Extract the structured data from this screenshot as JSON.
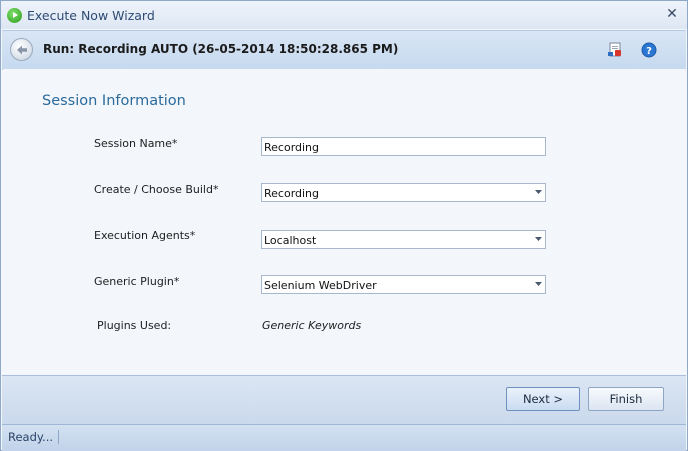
{
  "window": {
    "title": "Execute Now Wizard",
    "close_glyph": "✕",
    "icon": "play-icon"
  },
  "header": {
    "run_title": "Run: Recording AUTO (26-05-2014 18:50:28.865 PM)",
    "back_icon": "back-arrow-icon",
    "report_icon": "report-icon",
    "help_icon": "help-icon"
  },
  "section": {
    "title": "Session Information"
  },
  "form": {
    "session_name": {
      "label": "Session Name*",
      "value": "Recording"
    },
    "build": {
      "label": "Create / Choose Build*",
      "value": "Recording"
    },
    "agents": {
      "label": "Execution Agents*",
      "value": "Localhost"
    },
    "plugin": {
      "label": "Generic Plugin*",
      "value": "Selenium WebDriver"
    },
    "plugins_used": {
      "label": "Plugins Used:",
      "value": "Generic Keywords"
    }
  },
  "buttons": {
    "next": "Next >",
    "finish": "Finish"
  },
  "status": {
    "text": "Ready..."
  },
  "colors": {
    "accent": "#2b6a9c",
    "header_bg": "#c6d9ef",
    "footer_bg": "#cad9ec"
  }
}
